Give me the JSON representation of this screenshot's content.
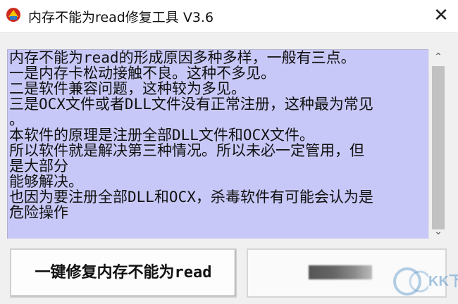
{
  "window": {
    "title": "内存不能为read修复工具 V3.6",
    "icon": "repair-app-icon",
    "close_glyph": "✕"
  },
  "description": {
    "lines": [
      "内存不能为read的形成原因多种多样，一般有三点。",
      "一是内存卡松动接触不良。这种不多见。",
      "二是软件兼容问题，这种较为多见。",
      "三是OCX文件或者DLL文件没有正常注册，这种最为常见",
      "。",
      "本软件的原理是注册全部DLL文件和OCX文件。",
      "所以软件就是解决第三种情况。所以未必一定管用，但",
      "是大部分",
      "能够解决。",
      "也因为要注册全部DLL和OCX，杀毒软件有可能会认为是",
      "危险操作"
    ]
  },
  "scrollbar": {
    "up_glyph": "⌃",
    "down_glyph": "⌄"
  },
  "buttons": {
    "fix_label": "一键修复内存不能为read"
  },
  "watermark": {
    "text": "KK下载"
  }
}
